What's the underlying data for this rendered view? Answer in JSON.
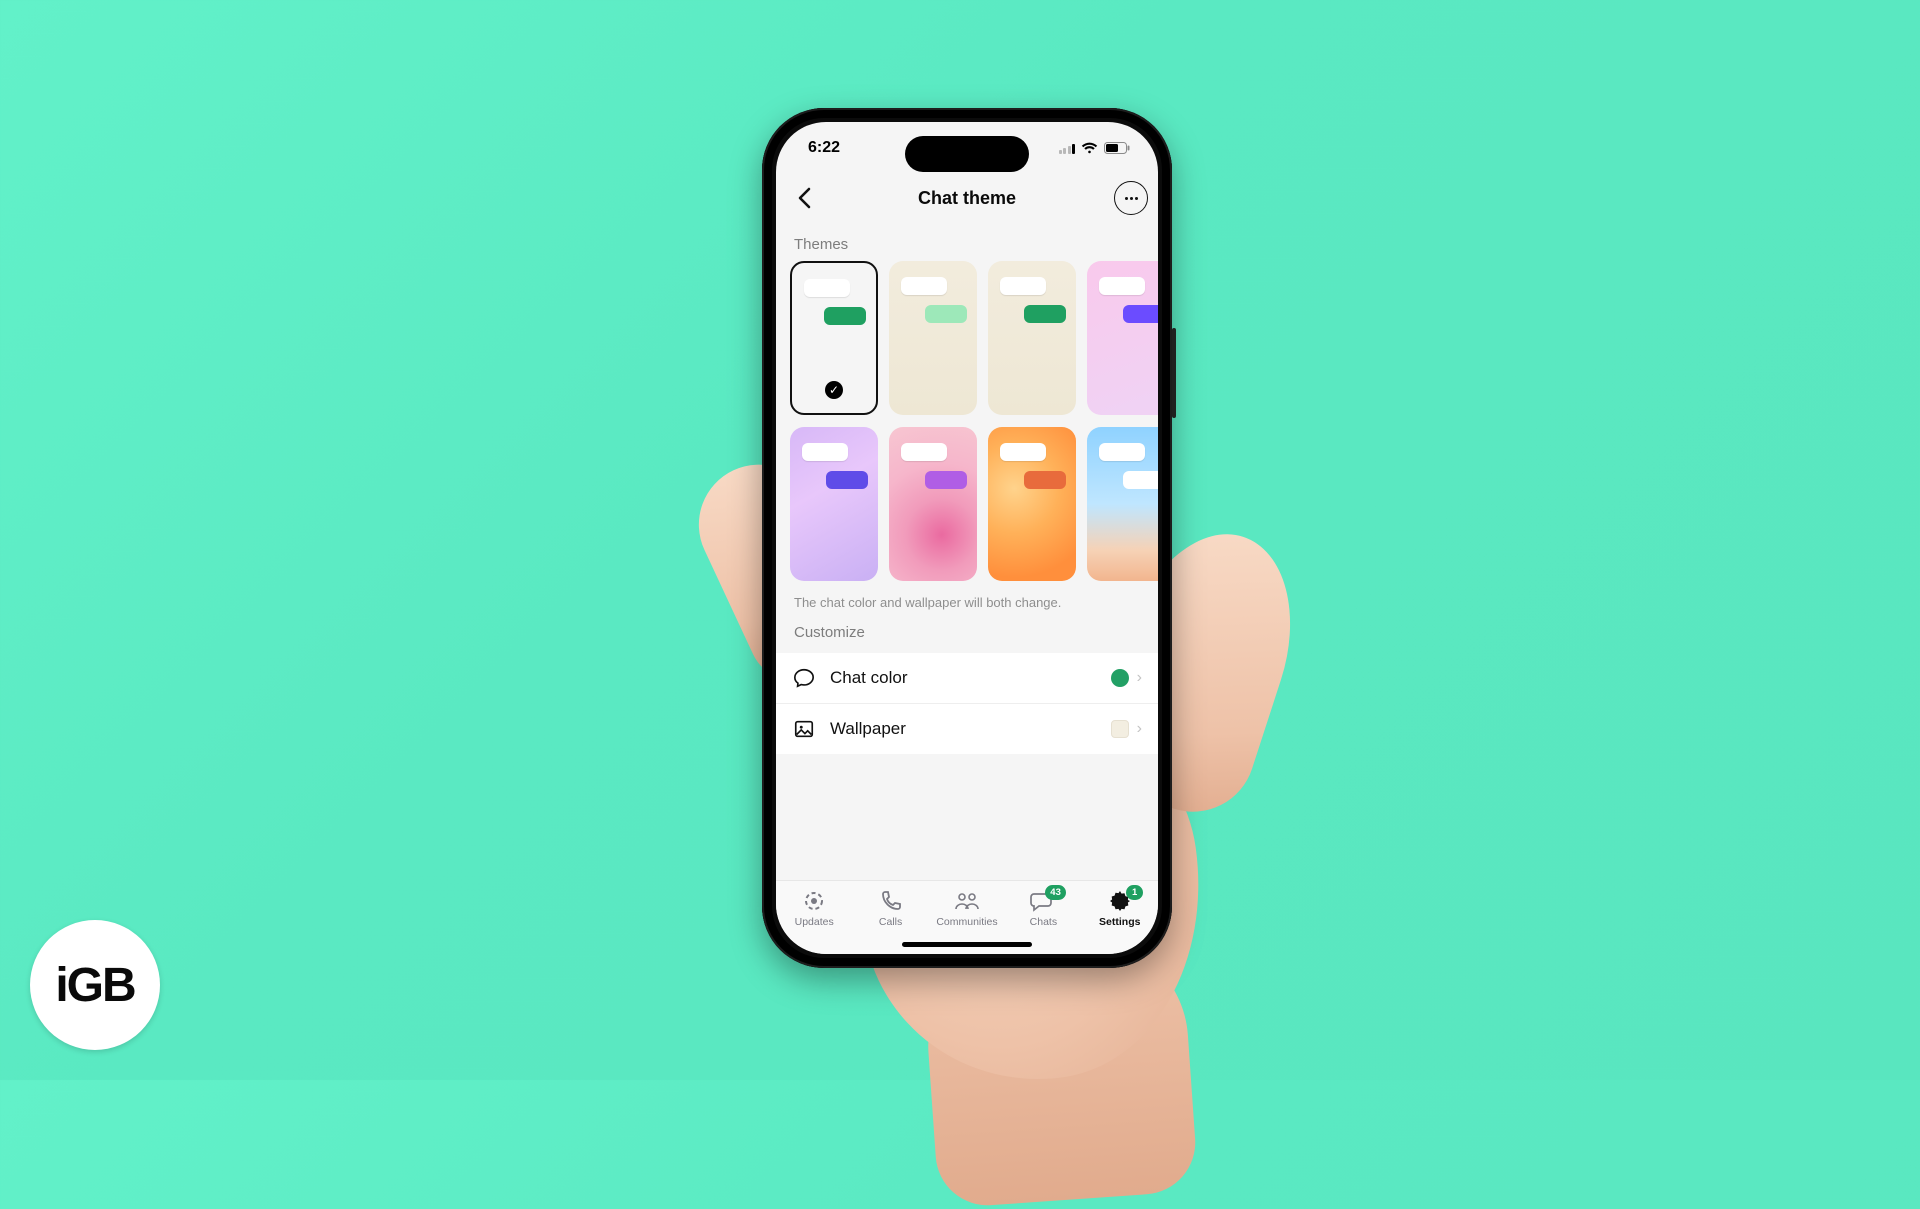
{
  "watermark": "iGB",
  "status": {
    "time": "6:22"
  },
  "header": {
    "title": "Chat theme"
  },
  "sections": {
    "themes_label": "Themes",
    "customize_label": "Customize",
    "help_text": "The chat color and wallpaper will both change."
  },
  "themes_row1": [
    {
      "bubble_color": "#1fa061",
      "bg_class": "bg-default",
      "selected": true
    },
    {
      "bubble_color": "#9de8b9",
      "bg_class": "bg-pastel",
      "selected": false
    },
    {
      "bubble_color": "#1fa061",
      "bg_class": "bg-pastel",
      "selected": false
    },
    {
      "bubble_color": "#6b4cff",
      "bg_class": "bg-pink-peek",
      "selected": false
    }
  ],
  "themes_row2": [
    {
      "bubble_color": "#5f4ce8",
      "bg_class": "bg-lilac"
    },
    {
      "bubble_color": "#b05ee5",
      "bg_class": "bg-floral"
    },
    {
      "bubble_color": "#e86b3c",
      "bg_class": "bg-orange"
    },
    {
      "bubble_color": "#ffffff",
      "bg_class": "bg-beach"
    }
  ],
  "customize": {
    "chat_color_label": "Chat color",
    "chat_color_value": "#22a065",
    "wallpaper_label": "Wallpaper"
  },
  "tabs": {
    "updates": {
      "label": "Updates"
    },
    "calls": {
      "label": "Calls"
    },
    "communities": {
      "label": "Communities"
    },
    "chats": {
      "label": "Chats",
      "badge": "43"
    },
    "settings": {
      "label": "Settings",
      "badge": "1",
      "active": true
    }
  }
}
